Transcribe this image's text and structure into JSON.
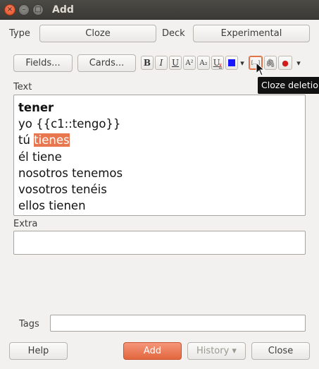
{
  "window": {
    "title": "Add",
    "close_glyph": "×",
    "min_glyph": "–",
    "max_glyph": "□"
  },
  "top_row": {
    "type_label": "Type",
    "type_value": "Cloze",
    "deck_label": "Deck",
    "deck_value": "Experimental"
  },
  "toolbar": {
    "fields_button": "Fields...",
    "cards_button": "Cards...",
    "bold": "B",
    "italic": "I",
    "underline": "U",
    "superscript": "A²",
    "subscript": "A₂",
    "clear_format": "U",
    "color_arrow": "▾",
    "cloze_glyph": "[...]",
    "attach_glyph": "🖇",
    "record_glyph": "●",
    "more_arrow": "▾",
    "text_color": "#1515ff"
  },
  "tooltip": "Cloze deletion (Ctrl+Shift+C)",
  "fields": {
    "text_label": "Text",
    "text_lines": {
      "l1": "tener",
      "l2": "yo {{c1::tengo}}",
      "l3_prefix": "tú ",
      "l3_highlight": "tienes",
      "l4": "él tiene",
      "l5": "nosotros tenemos",
      "l6": "vosotros tenéis",
      "l7": "ellos tienen"
    },
    "extra_label": "Extra"
  },
  "tags_label": "Tags",
  "bottom": {
    "help": "Help",
    "add": "Add",
    "history": "History ▾",
    "close": "Close"
  },
  "colors": {
    "accent": "#e8774f",
    "titlebar": "#3c3b37"
  }
}
